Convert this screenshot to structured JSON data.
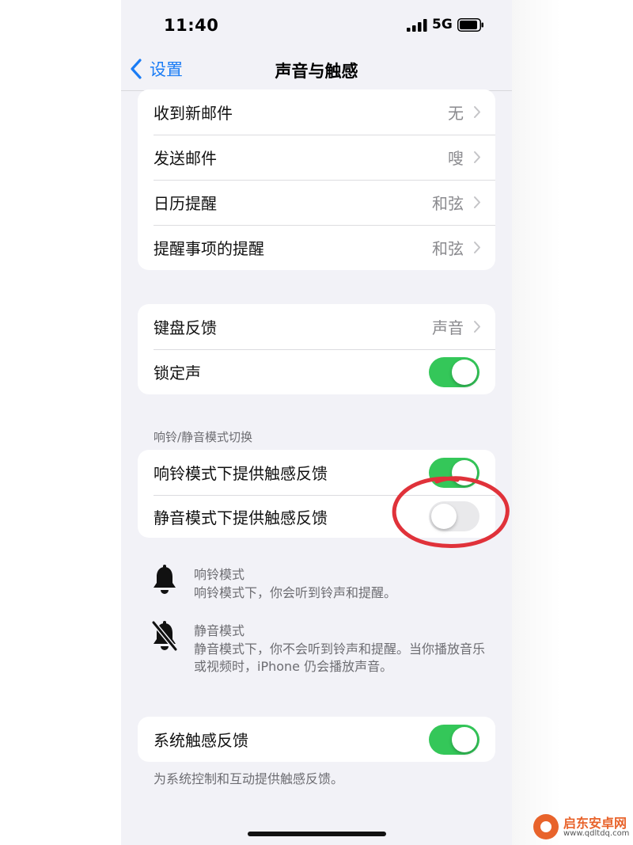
{
  "status_bar": {
    "time": "11:40",
    "network": "5G"
  },
  "nav": {
    "back_label": "设置",
    "title": "声音与触感"
  },
  "alerts_group": [
    {
      "label": "收到新邮件",
      "value": "无"
    },
    {
      "label": "发送邮件",
      "value": "嗖"
    },
    {
      "label": "日历提醒",
      "value": "和弦"
    },
    {
      "label": "提醒事项的提醒",
      "value": "和弦"
    }
  ],
  "keyboard_group": {
    "keyboard_feedback": {
      "label": "键盘反馈",
      "value": "声音"
    },
    "lock_sound": {
      "label": "锁定声",
      "on": true
    }
  },
  "ring_silent": {
    "header": "响铃/静音模式切换",
    "ring_haptics": {
      "label": "响铃模式下提供触感反馈",
      "on": true
    },
    "silent_haptics": {
      "label": "静音模式下提供触感反馈",
      "on": false
    }
  },
  "modes": {
    "ring": {
      "icon": "bell-icon",
      "title": "响铃模式",
      "desc": "响铃模式下，你会听到铃声和提醒。"
    },
    "silent": {
      "icon": "bell-slash-icon",
      "title": "静音模式",
      "desc": "静音模式下，你不会听到铃声和提醒。当你播放音乐或视频时，iPhone 仍会播放声音。"
    }
  },
  "system_haptics": {
    "label": "系统触感反馈",
    "on": true,
    "footer": "为系统控制和互动提供触感反馈。"
  },
  "watermark": {
    "name": "启东安卓网",
    "url": "www.qdltdq.com"
  },
  "colors": {
    "accent": "#1a7cf5",
    "toggle_on": "#34c759",
    "annotation": "#e0323a"
  }
}
